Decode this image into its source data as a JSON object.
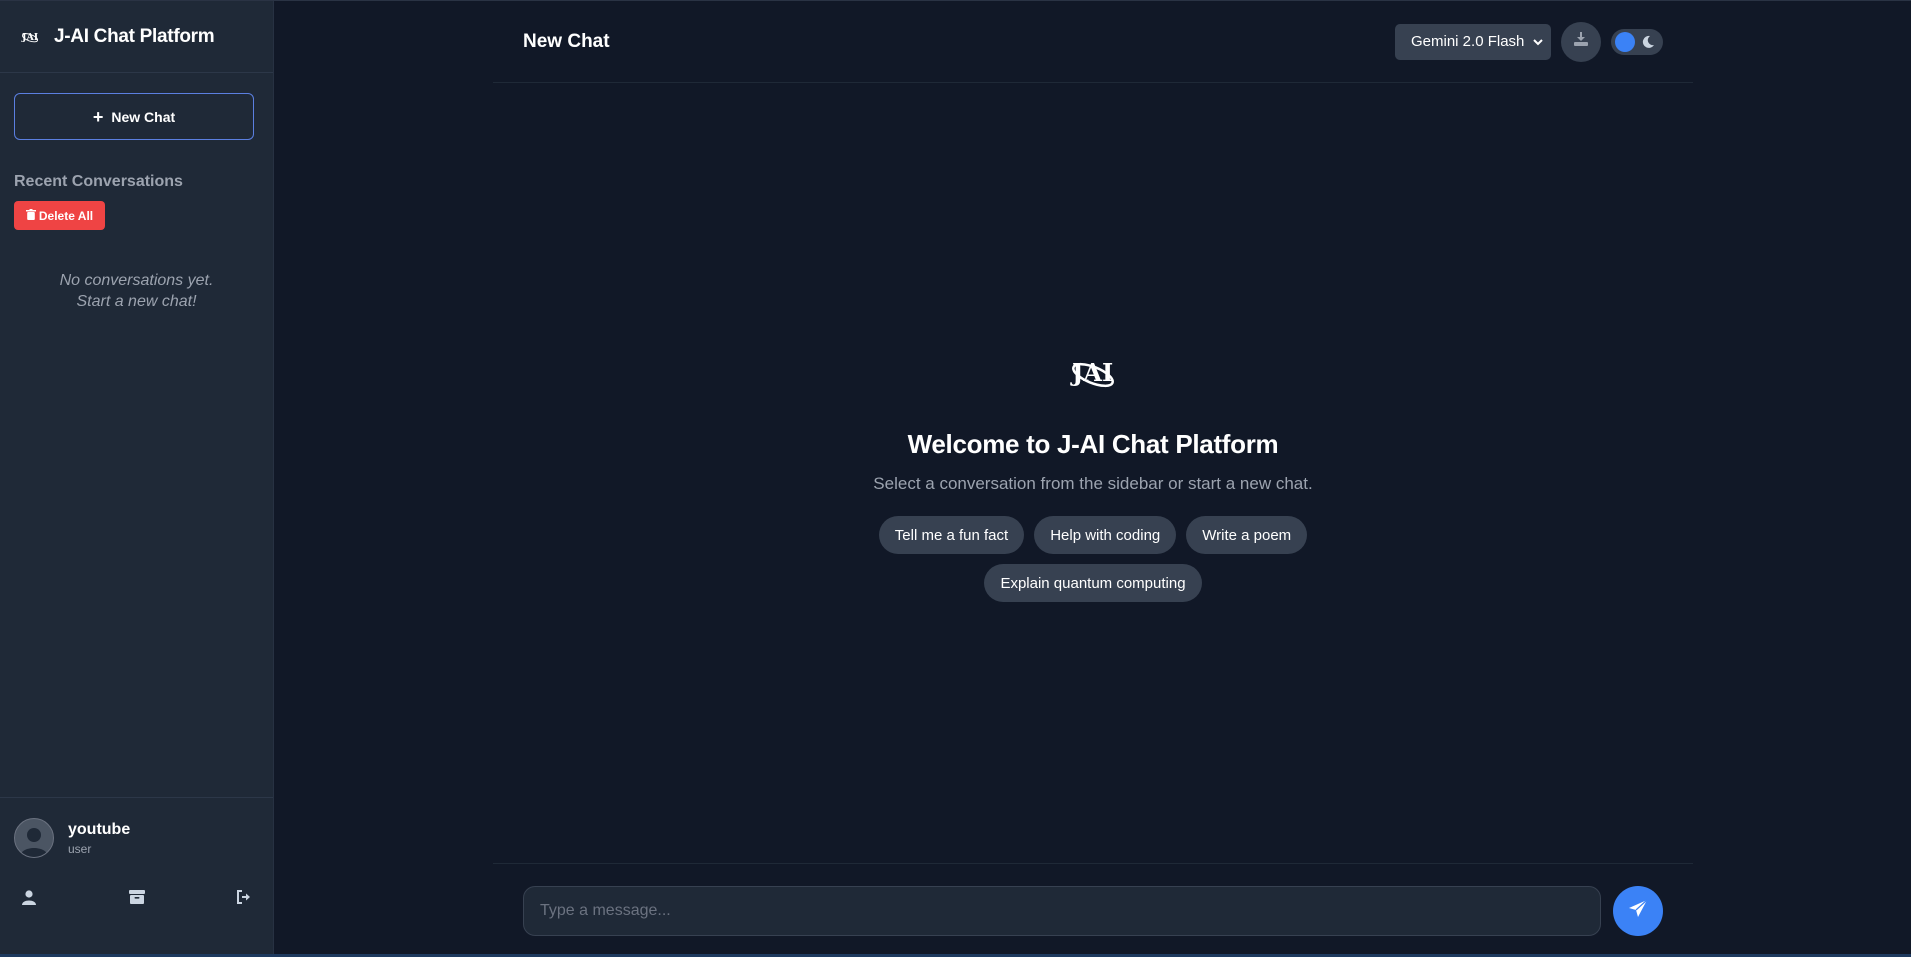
{
  "sidebar": {
    "brand_title": "J-AI Chat Platform",
    "new_chat_label": "New Chat",
    "recent_title": "Recent Conversations",
    "delete_all_label": "Delete All",
    "empty_line1": "No conversations yet.",
    "empty_line2": "Start a new chat!",
    "user": {
      "name": "youtube",
      "role": "user"
    }
  },
  "header": {
    "title": "New Chat",
    "model_selected": "Gemini 2.0 Flash"
  },
  "welcome": {
    "title": "Welcome to J-AI Chat Platform",
    "subtitle": "Select a conversation from the sidebar or start a new chat.",
    "suggestions": [
      "Tell me a fun fact",
      "Help with coding",
      "Write a poem",
      "Explain quantum computing"
    ]
  },
  "composer": {
    "placeholder": "Type a message..."
  },
  "colors": {
    "background": "#111827",
    "sidebar": "#1f2937",
    "accent": "#3b82f6",
    "danger": "#ef4444"
  },
  "icons": {
    "logo": "jai-logo-icon",
    "new_chat": "plus-icon",
    "delete": "trash-icon",
    "avatar": "user-avatar-icon",
    "profile": "user-icon",
    "archive": "archive-icon",
    "logout": "logout-icon",
    "download": "download-icon",
    "theme": "moon-icon",
    "send": "paper-plane-icon"
  }
}
